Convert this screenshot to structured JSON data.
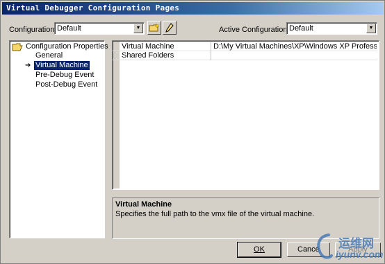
{
  "window": {
    "title": "Virtual Debugger Configuration Pages"
  },
  "toolbar": {
    "configuration_label": "Configuration:",
    "configuration_value": "Default",
    "active_configuration_label": "Active Configuration:",
    "active_configuration_value": "Default"
  },
  "tree": {
    "root": "Configuration Properties",
    "items": [
      {
        "label": "General"
      },
      {
        "label": "Virtual Machine",
        "selected": true
      },
      {
        "label": "Pre-Debug Event"
      },
      {
        "label": "Post-Debug Event"
      }
    ]
  },
  "grid": {
    "rows": [
      {
        "name": "Virtual Machine",
        "value": "D:\\My Virtual Machines\\XP\\Windows XP Professional.vmx"
      },
      {
        "name": "Shared Folders",
        "value": ""
      }
    ]
  },
  "description": {
    "title": "Virtual Machine",
    "text": "Specifies the full path to the vmx file of the virtual machine."
  },
  "buttons": {
    "ok": "OK",
    "cancel": "Cance",
    "apply": "Apply"
  },
  "watermark": {
    "text_cn": "运维网",
    "text_url": "iyunv.com"
  },
  "colors": {
    "titlebar_start": "#0a246a",
    "selection": "#0a246a",
    "face": "#d4d0c8"
  }
}
